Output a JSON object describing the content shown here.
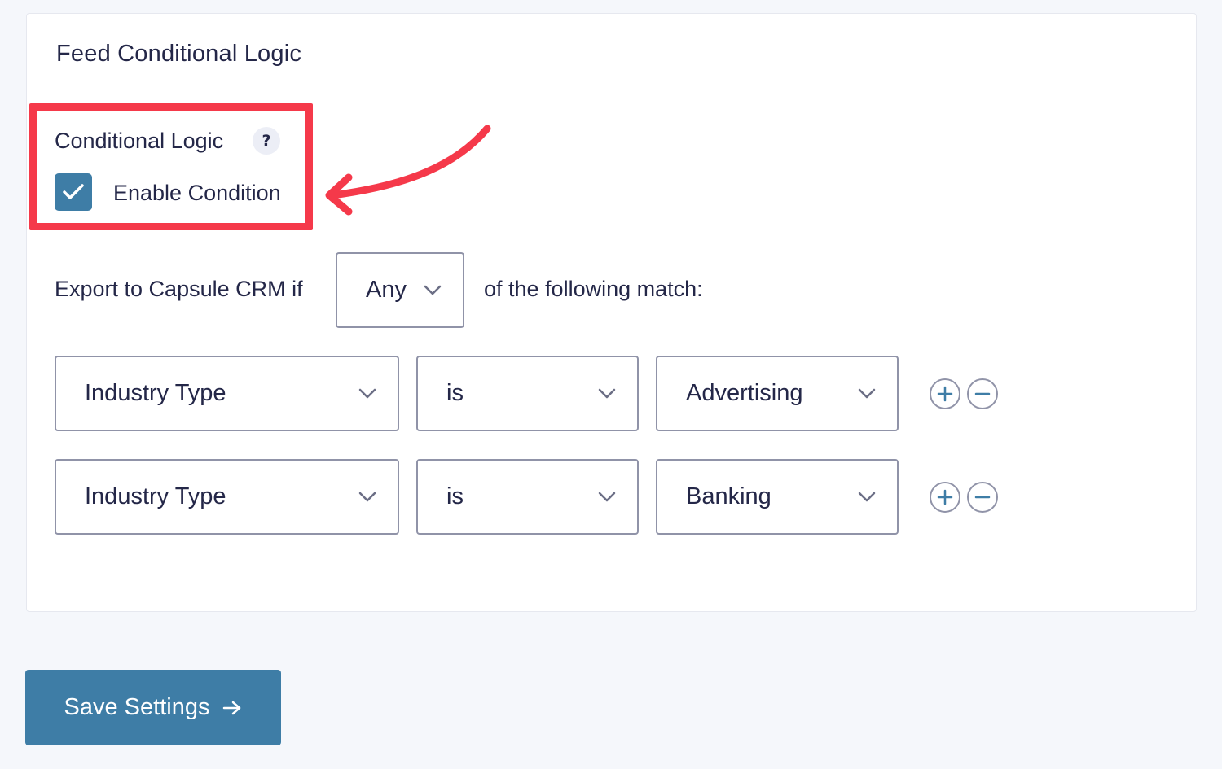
{
  "panel": {
    "title": "Feed Conditional Logic"
  },
  "conditional_logic": {
    "label": "Conditional Logic",
    "help_glyph": "?",
    "enable_label": "Enable Condition",
    "enabled": true
  },
  "export_rule": {
    "prefix": "Export to Capsule CRM if",
    "match_type": "Any",
    "suffix": "of the following match:"
  },
  "rules": [
    {
      "field": "Industry Type",
      "operator": "is",
      "value": "Advertising"
    },
    {
      "field": "Industry Type",
      "operator": "is",
      "value": "Banking"
    }
  ],
  "save": {
    "label": "Save Settings"
  },
  "colors": {
    "accent": "#3e7da6",
    "highlight": "#f5394a",
    "text": "#242748"
  },
  "icons": {
    "checkbox": "check-icon",
    "select": "chevron-down-icon",
    "add": "plus-icon",
    "remove": "minus-icon",
    "save": "arrow-right-icon",
    "annotation": "curved-arrow-icon"
  }
}
